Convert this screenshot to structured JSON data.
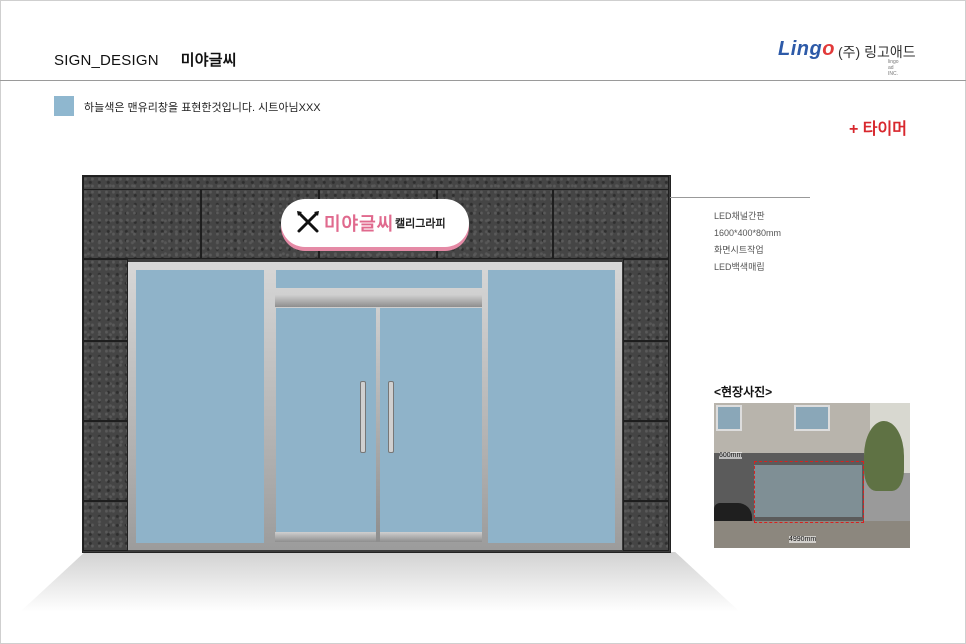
{
  "header": {
    "doc_type": "SIGN_DESIGN",
    "store_name": "미야글씨",
    "brand": {
      "logo_main": "Ling",
      "logo_o": "o",
      "company": "(주) 링고애드",
      "company_sub": "lingo ad INC."
    }
  },
  "legend": {
    "swatch_color": "#8fb7cf",
    "text": "하늘색은 맨유리창을 표현한것입니다. 시트아님XXX"
  },
  "addon_label": "+ 타이머",
  "sign": {
    "name": "미야글씨",
    "tagline": "캘리그라피",
    "icon": "pen-brush-cross-icon",
    "accent_color": "#e06a8e"
  },
  "specs": [
    "LED채널간판",
    "1600*400*80mm",
    "화면시트작업",
    "LED백색매립"
  ],
  "site_photo": {
    "label": "<현장사진>",
    "height_dim": "600mm",
    "width_dim": "4990mm"
  }
}
